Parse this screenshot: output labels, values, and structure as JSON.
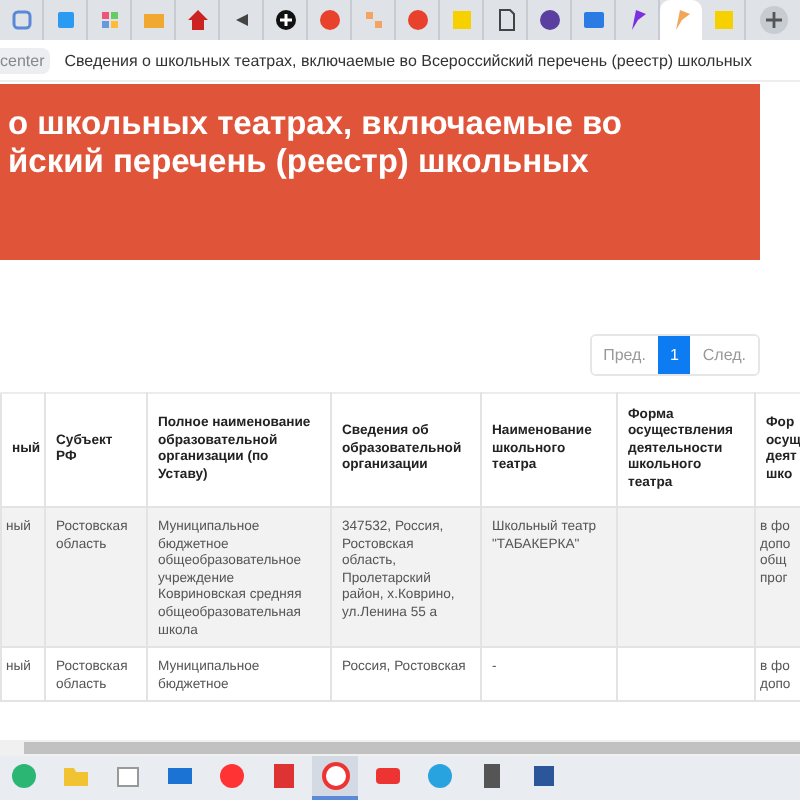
{
  "browser": {
    "tabs": [
      {
        "selected": false
      },
      {
        "selected": false
      },
      {
        "selected": false
      },
      {
        "selected": false
      },
      {
        "selected": false
      },
      {
        "selected": false
      },
      {
        "selected": false
      },
      {
        "selected": false
      },
      {
        "selected": false
      },
      {
        "selected": false
      },
      {
        "selected": false
      },
      {
        "selected": false
      },
      {
        "selected": false
      },
      {
        "selected": false
      },
      {
        "selected": false
      },
      {
        "selected": true
      },
      {
        "selected": false
      }
    ],
    "site_badge": "center",
    "page_title": "Сведения о школьных театрах, включаемые во Всероссийский перечень (реестр) школьных"
  },
  "banner": {
    "title_lines": [
      "о школьных театрах, включаемые во",
      "йский перечень (реестр) школьных"
    ]
  },
  "pagination": {
    "prev": "Пред.",
    "pages": [
      {
        "label": "1",
        "selected": true
      }
    ],
    "next": "След."
  },
  "table": {
    "columns": [
      "ный",
      "Субъект РФ",
      "Полное наименование образовательной организации (по Уставу)",
      "Сведения об образовательной организации",
      "Наименование школьного театра",
      "Форма осуществления деятельности школьного театра",
      "Фор осущ деят шко"
    ],
    "rows": [
      [
        "ный",
        "Ростовская область",
        "Муниципальное бюджетное общеобразовательное учреждение Ковриновская средняя общеобразовательная школа",
        "347532, Россия, Ростовская область, Пролетарский район, х.Коврино, ул.Ленина 55 а",
        "Школьный театр \"ТАБАКЕРКА\"",
        "",
        "в фо допо общ прог"
      ],
      [
        "ный",
        "Ростовская область",
        "Муниципальное бюджетное",
        "Россия, Ростовская",
        "-",
        "",
        "в фо допо"
      ]
    ]
  },
  "taskbar": {
    "items": [
      {
        "selected": false
      },
      {
        "selected": false
      },
      {
        "selected": false
      },
      {
        "selected": false
      },
      {
        "selected": false
      },
      {
        "selected": false
      },
      {
        "selected": true
      },
      {
        "selected": false
      },
      {
        "selected": false
      },
      {
        "selected": false
      },
      {
        "selected": false
      }
    ]
  }
}
